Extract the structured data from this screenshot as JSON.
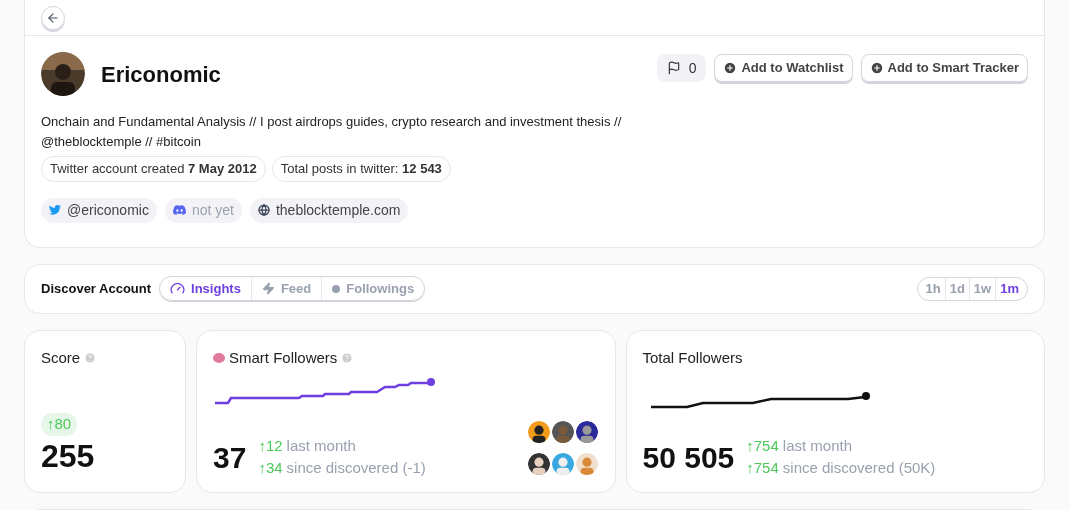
{
  "profile": {
    "name": "Ericonomic",
    "bio": "Onchain and Fundamental Analysis // I post airdrops guides, crypto research and investment thesis // @theblocktemple // #bitcoin",
    "facts": [
      "Twitter account created **7 May 2012**",
      "Total posts in twitter: **12 543**"
    ],
    "links": [
      {
        "kind": "twitter",
        "label": "@ericonomic"
      },
      {
        "kind": "discord",
        "label": "not yet"
      },
      {
        "kind": "web",
        "label": "theblocktemple.com"
      }
    ],
    "flag_count": "0",
    "buttons": [
      "Add to Watchlist",
      "Add to Smart Tracker"
    ]
  },
  "discover": {
    "title": "Discover Account",
    "tabs": [
      {
        "kind": "insights",
        "label": "Insights",
        "selected": true
      },
      {
        "kind": "feed",
        "label": "Feed",
        "selected": false
      },
      {
        "kind": "followings",
        "label": "Followings",
        "selected": false
      }
    ],
    "periods": [
      {
        "label": "1h",
        "selected": false
      },
      {
        "label": "1d",
        "selected": false
      },
      {
        "label": "1w",
        "selected": false
      },
      {
        "label": "1m",
        "selected": true
      }
    ]
  },
  "score": {
    "title": "Score",
    "change": "↑80",
    "value": "255"
  },
  "smart_followers": {
    "title": "Smart Followers",
    "value": "37",
    "stats": [
      {
        "change": "↑12",
        "text": "last month"
      },
      {
        "change": "↑34",
        "text": "since discovered (-1)"
      }
    ]
  },
  "total_followers": {
    "title": "Total Followers",
    "value": "50 505",
    "stats": [
      {
        "change": "↑754",
        "text": "last month"
      },
      {
        "change": "↑754",
        "text": "since discovered (50K)"
      }
    ]
  }
}
